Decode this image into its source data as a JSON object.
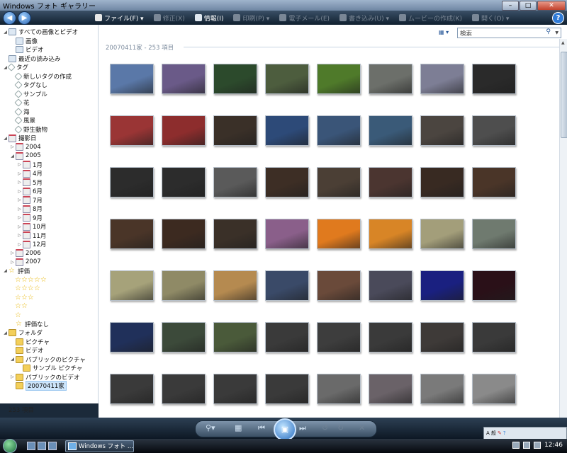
{
  "window": {
    "title": "Windows フォト ギャラリー"
  },
  "menu": {
    "items": [
      {
        "label": "ファイル(F) ▾",
        "enabled": true,
        "color": "#e8e8e8"
      },
      {
        "label": "修正(X)",
        "enabled": false,
        "color": "#7a8796"
      },
      {
        "label": "情報(I)",
        "enabled": true,
        "color": "#e0e8f0"
      },
      {
        "label": "印刷(P) ▾",
        "enabled": false,
        "color": "#7a8796"
      },
      {
        "label": "電子メール(E)",
        "enabled": false,
        "color": "#7a8796"
      },
      {
        "label": "書き込み(U) ▾",
        "enabled": false,
        "color": "#7a8796"
      },
      {
        "label": "ムービーの作成(K)",
        "enabled": false,
        "color": "#7a8796"
      },
      {
        "label": "開く(O) ▾",
        "enabled": false,
        "color": "#7a8796"
      }
    ]
  },
  "search": {
    "placeholder": "検索"
  },
  "group": {
    "header": "20070411家 - 253 項目"
  },
  "tree": [
    {
      "label": "すべての画像とビデオ",
      "level": 0,
      "twisty": "◢",
      "icon": "img",
      "icon_name": "gallery-icon"
    },
    {
      "label": "画像",
      "level": 1,
      "twisty": "",
      "icon": "img",
      "icon_name": "picture-icon"
    },
    {
      "label": "ビデオ",
      "level": 1,
      "twisty": "",
      "icon": "img",
      "icon_name": "video-icon"
    },
    {
      "label": "最近の読み込み",
      "level": 0,
      "twisty": "",
      "icon": "img",
      "icon_name": "recent-import-icon"
    },
    {
      "label": "タグ",
      "level": 0,
      "twisty": "◢",
      "icon": "tag",
      "icon_name": "tag-icon"
    },
    {
      "label": "新しいタグの作成",
      "level": 1,
      "twisty": "",
      "icon": "tag",
      "icon_name": "new-tag-icon"
    },
    {
      "label": "タグなし",
      "level": 1,
      "twisty": "",
      "icon": "tag",
      "icon_name": "tag-icon"
    },
    {
      "label": "サンプル",
      "level": 1,
      "twisty": "",
      "icon": "tag",
      "icon_name": "tag-icon"
    },
    {
      "label": "花",
      "level": 1,
      "twisty": "",
      "icon": "tag",
      "icon_name": "tag-icon"
    },
    {
      "label": "海",
      "level": 1,
      "twisty": "",
      "icon": "tag",
      "icon_name": "tag-icon"
    },
    {
      "label": "風景",
      "level": 1,
      "twisty": "",
      "icon": "tag",
      "icon_name": "tag-icon"
    },
    {
      "label": "野生動物",
      "level": 1,
      "twisty": "",
      "icon": "tag",
      "icon_name": "tag-icon"
    },
    {
      "label": "撮影日",
      "level": 0,
      "twisty": "◢",
      "icon": "cal",
      "icon_name": "calendar-icon"
    },
    {
      "label": "2004",
      "level": 1,
      "twisty": "▷",
      "icon": "cal",
      "icon_name": "calendar-icon"
    },
    {
      "label": "2005",
      "level": 1,
      "twisty": "◢",
      "icon": "cal",
      "icon_name": "calendar-icon"
    },
    {
      "label": "1月",
      "level": 2,
      "twisty": "▷",
      "icon": "cal",
      "icon_name": "calendar-icon"
    },
    {
      "label": "4月",
      "level": 2,
      "twisty": "▷",
      "icon": "cal",
      "icon_name": "calendar-icon"
    },
    {
      "label": "5月",
      "level": 2,
      "twisty": "▷",
      "icon": "cal",
      "icon_name": "calendar-icon"
    },
    {
      "label": "6月",
      "level": 2,
      "twisty": "▷",
      "icon": "cal",
      "icon_name": "calendar-icon"
    },
    {
      "label": "7月",
      "level": 2,
      "twisty": "▷",
      "icon": "cal",
      "icon_name": "calendar-icon"
    },
    {
      "label": "8月",
      "level": 2,
      "twisty": "▷",
      "icon": "cal",
      "icon_name": "calendar-icon"
    },
    {
      "label": "9月",
      "level": 2,
      "twisty": "▷",
      "icon": "cal",
      "icon_name": "calendar-icon"
    },
    {
      "label": "10月",
      "level": 2,
      "twisty": "▷",
      "icon": "cal",
      "icon_name": "calendar-icon"
    },
    {
      "label": "11月",
      "level": 2,
      "twisty": "▷",
      "icon": "cal",
      "icon_name": "calendar-icon"
    },
    {
      "label": "12月",
      "level": 2,
      "twisty": "▷",
      "icon": "cal",
      "icon_name": "calendar-icon"
    },
    {
      "label": "2006",
      "level": 1,
      "twisty": "▷",
      "icon": "cal",
      "icon_name": "calendar-icon"
    },
    {
      "label": "2007",
      "level": 1,
      "twisty": "▷",
      "icon": "cal",
      "icon_name": "calendar-icon"
    },
    {
      "label": "評価",
      "level": 0,
      "twisty": "◢",
      "icon": "star",
      "icon_name": "rating-icon"
    },
    {
      "stars": "☆☆☆☆☆",
      "level": 1,
      "twisty": "",
      "icon": "",
      "icon_name": ""
    },
    {
      "stars": "☆☆☆☆",
      "level": 1,
      "twisty": "",
      "icon": "",
      "icon_name": ""
    },
    {
      "stars": "☆☆☆",
      "level": 1,
      "twisty": "",
      "icon": "",
      "icon_name": ""
    },
    {
      "stars": "☆☆",
      "level": 1,
      "twisty": "",
      "icon": "",
      "icon_name": ""
    },
    {
      "stars": "☆",
      "level": 1,
      "twisty": "",
      "icon": "",
      "icon_name": ""
    },
    {
      "label": "評価なし",
      "level": 1,
      "twisty": "",
      "icon": "star",
      "icon_name": "no-rating-icon"
    },
    {
      "label": "フォルダ",
      "level": 0,
      "twisty": "◢",
      "icon": "folder",
      "icon_name": "folder-icon"
    },
    {
      "label": "ピクチャ",
      "level": 1,
      "twisty": "",
      "icon": "folder",
      "icon_name": "folder-icon"
    },
    {
      "label": "ビデオ",
      "level": 1,
      "twisty": "",
      "icon": "folder",
      "icon_name": "folder-icon"
    },
    {
      "label": "パブリックのピクチャ",
      "level": 1,
      "twisty": "◢",
      "icon": "folder",
      "icon_name": "folder-icon"
    },
    {
      "label": "サンプル ピクチャ",
      "level": 2,
      "twisty": "",
      "icon": "folder",
      "icon_name": "folder-icon"
    },
    {
      "label": "パブリックのビデオ",
      "level": 1,
      "twisty": "▷",
      "icon": "folder",
      "icon_name": "folder-icon"
    },
    {
      "label": "20070411家",
      "level": 1,
      "twisty": "",
      "icon": "folder",
      "icon_name": "folder-icon",
      "selected": true
    }
  ],
  "status": {
    "count": "253 項目"
  },
  "taskbar": {
    "task_label": "Windows フォト ...",
    "time": "12:46",
    "tray_text": "A 般"
  },
  "thumbnail_colors": [
    [
      "#5a78a8",
      "#6a5a88",
      "#2c4a2c",
      "#4d5d3e",
      "#4f7a2a",
      "#6c6f6a",
      "#7d7e95",
      "#2a2a2a"
    ],
    [
      "#9a3535",
      "#8d2d2d",
      "#3a3028",
      "#2d4a78",
      "#3a5578",
      "#3a5a78",
      "#4b4540",
      "#4e4e4e"
    ],
    [
      "#2c2c2c",
      "#2c2c2c",
      "#5a5a5a",
      "#3d2e25",
      "#4b3f35",
      "#4b3530",
      "#382a22",
      "#4a3528"
    ],
    [
      "#4a3528",
      "#3c2a20",
      "#3a3028",
      "#8a5f8a",
      "#e07a1e",
      "#d88526",
      "#a39e7a",
      "#6f7a6f"
    ],
    [
      "#a6a27a",
      "#8f8a66",
      "#b58a50",
      "#3a4a68",
      "#6a4a3a",
      "#4a4a5a",
      "#1a2080",
      "#2a1018"
    ],
    [
      "#20305a",
      "#3c4a3a",
      "#4a5a3a",
      "#3a3a3a",
      "#3d3d3d",
      "#3a3a3a",
      "#3e3a38",
      "#3a3a3a"
    ],
    [
      "#3a3a3a",
      "#3a3a3a",
      "#3a3a3a",
      "#3a3a3a",
      "#6a6a6a",
      "#6a6268",
      "#7a7a7a",
      "#8a8a8a"
    ]
  ]
}
